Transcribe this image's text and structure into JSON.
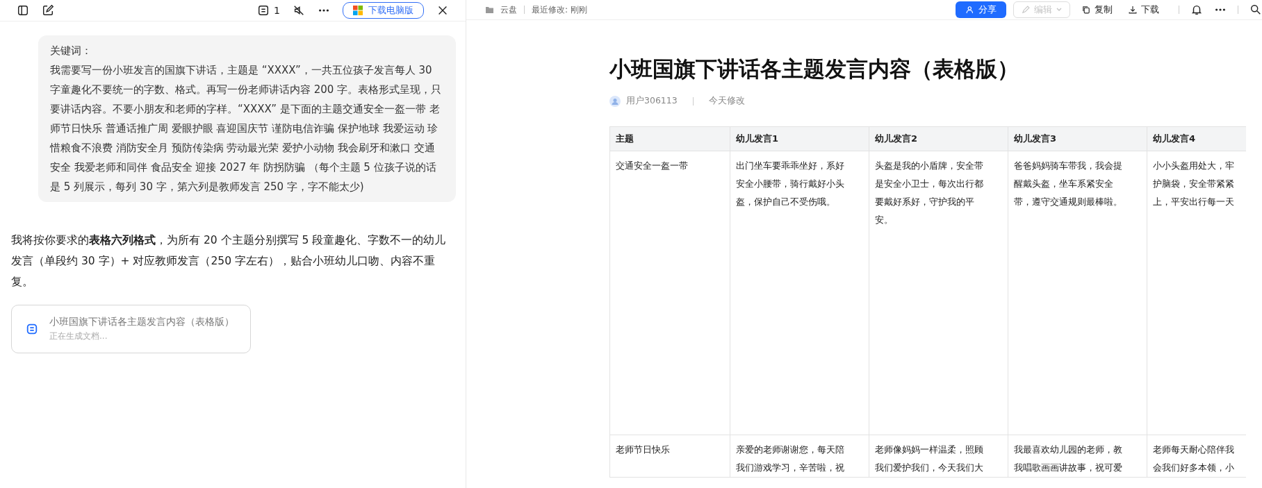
{
  "left_toolbar": {
    "count": "1",
    "download_button": "下载电脑版"
  },
  "user_message": {
    "heading": "关键词：",
    "body": "我需要写一份小班发言的国旗下讲话，主题是 “XXXX”，一共五位孩子发言每人 30 字童趣化不要统一的字数、格式。再写一份老师讲话内容 200 字。表格形式呈现，只要讲话内容。不要小朋友和老师的字样。“XXXX” 是下面的主题交通安全一盔一带 老师节日快乐 普通话推广周 爱眼护眼 喜迎国庆节 谨防电信诈骗 保护地球 我爱运动 珍惜粮食不浪费 消防安全月 预防传染病 劳动最光荣 爱护小动物 我会刷牙和漱口 交通安全 我爱老师和同伴 食品安全 迎接 2027 年 防拐防骗 （每个主题 5 位孩子说的话是 5 列展示，每列 30 字，第六列是教师发言 250 字，字不能太少)"
  },
  "assistant_reply": "我将按你要求的**表格六列格式**，为所有 20 个主题分别撰写 5 段童趣化、字数不一的幼儿发言（单段约 30 字）+ 对应教师发言（250 字左右），贴合小班幼儿口吻、内容不重复。",
  "doc_card": {
    "title": "小班国旗下讲话各主题发言内容（表格版）",
    "status": "正在生成文档..."
  },
  "doc_header": {
    "breadcrumb": [
      "云盘",
      "最近修改: 刚刚"
    ],
    "buttons": [
      {
        "kind": "primary",
        "label": "分享",
        "disabled": false
      },
      {
        "kind": "dropdown",
        "label": "编辑",
        "disabled": true
      },
      {
        "kind": "copy",
        "label": "复制",
        "disabled": false
      },
      {
        "kind": "download",
        "label": "下载",
        "disabled": false
      }
    ]
  },
  "document": {
    "title": "小班国旗下讲话各主题发言内容（表格版）",
    "author": "用户306113",
    "modified": "今天修改",
    "table": {
      "columns": [
        "主题",
        "幼儿发言1",
        "幼儿发言2",
        "幼儿发言3",
        "幼儿发言4"
      ],
      "rows": [
        [
          [
            "交通安全一盔一带"
          ],
          [
            "出门坐车要乖乖坐好，系好",
            "安全小腰带，骑行戴好小头",
            "盔，保护自己不受伤哦。"
          ],
          [
            "头盔是我的小盾牌，安全带",
            "是安全小卫士，每次出行都",
            "要戴好系好，守护我的平",
            "安。"
          ],
          [
            "爸爸妈妈骑车带我，我会提",
            "醒戴头盔，坐车系紧安全",
            "带，遵守交通规则最棒啦。"
          ],
          [
            "小小头盔用处大，牢",
            "护脑袋，安全带紧紧",
            "上，平安出行每一天"
          ]
        ],
        [
          [
            "老师节日快乐"
          ],
          [
            "亲爱的老师谢谢您，每天陪",
            "我们游戏学习，辛苦啦，祝"
          ],
          [
            "老师像妈妈一样温柔，照顾",
            "我们爱护我们，今天我们大"
          ],
          [
            "我最喜欢幼儿园的老师，教",
            "我唱歌画画讲故事，祝可爱"
          ],
          [
            "老师每天耐心陪伴我",
            "会我们好多本领，小"
          ]
        ]
      ]
    }
  }
}
